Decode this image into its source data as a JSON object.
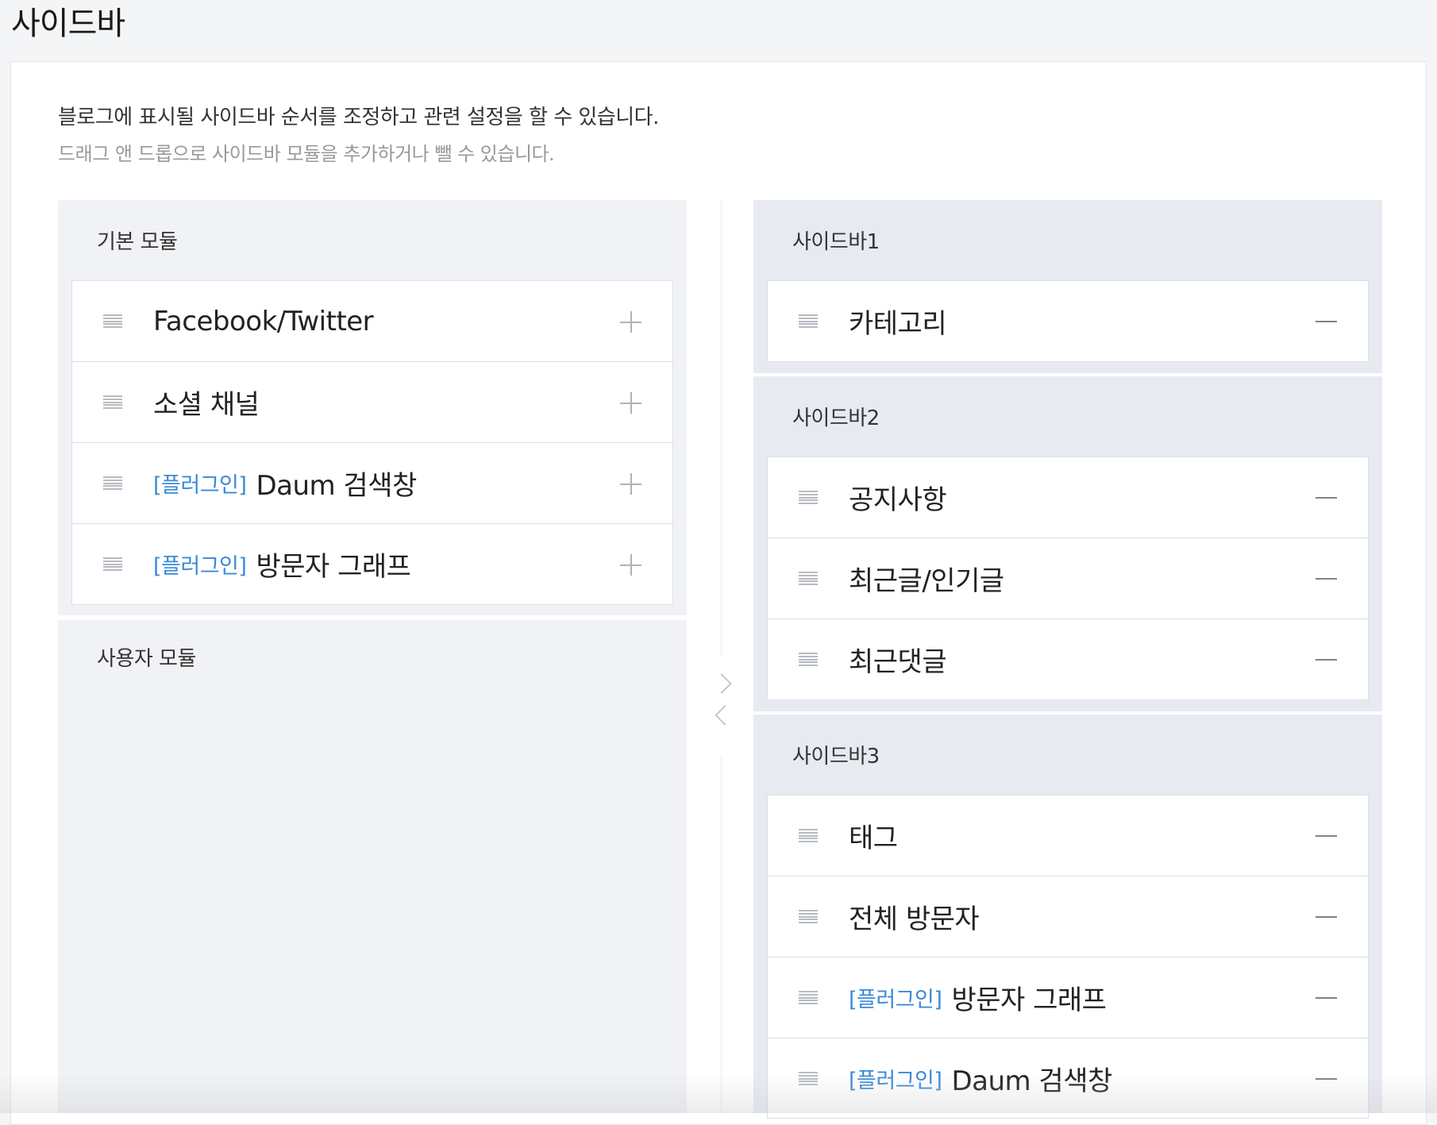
{
  "page": {
    "title": "사이드바",
    "description": "블로그에 표시될 사이드바 순서를 조정하고 관련 설정을 할 수 있습니다.",
    "subdescription": "드래그 앤 드롭으로 사이드바 모듈을 추가하거나 뺄 수 있습니다."
  },
  "basic_modules": {
    "title": "기본 모듈",
    "items": [
      {
        "tag": "",
        "label": "Facebook/Twitter"
      },
      {
        "tag": "",
        "label": "소셜 채널"
      },
      {
        "tag": "[플러그인]",
        "label": "Daum 검색창"
      },
      {
        "tag": "[플러그인]",
        "label": "방문자 그래프"
      }
    ]
  },
  "user_modules": {
    "title": "사용자 모듈"
  },
  "sidebar1": {
    "title": "사이드바1",
    "items": [
      {
        "tag": "",
        "label": "카테고리"
      }
    ]
  },
  "sidebar2": {
    "title": "사이드바2",
    "items": [
      {
        "tag": "",
        "label": "공지사항"
      },
      {
        "tag": "",
        "label": "최근글/인기글"
      },
      {
        "tag": "",
        "label": "최근댓글"
      }
    ]
  },
  "sidebar3": {
    "title": "사이드바3",
    "items": [
      {
        "tag": "",
        "label": "태그"
      },
      {
        "tag": "",
        "label": "전체 방문자"
      },
      {
        "tag": "[플러그인]",
        "label": "방문자 그래프"
      },
      {
        "tag": "[플러그인]",
        "label": "Daum 검색창"
      }
    ]
  },
  "icons": {
    "drag": "drag-handle-icon",
    "add": "plus-icon",
    "remove": "minus-icon",
    "move_right": "chevron-right-icon",
    "move_left": "chevron-left-icon"
  },
  "colors": {
    "plugin_tag": "#3a8ad8",
    "left_group_bg": "#f0f2f5",
    "right_group_bg": "#e7ebf1"
  }
}
